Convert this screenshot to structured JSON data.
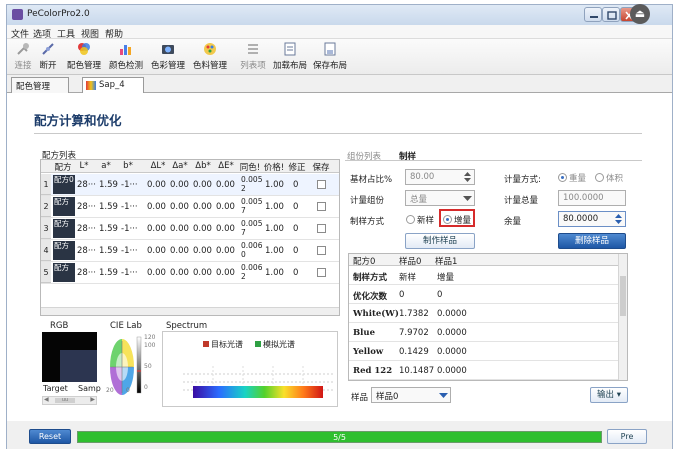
{
  "app": {
    "title": "PeColorPro2.0"
  },
  "menu": [
    "文件",
    "选项",
    "工具",
    "视图",
    "帮助"
  ],
  "toolbar": [
    {
      "label": "连接",
      "icon": "connect-icon",
      "enabled": false
    },
    {
      "label": "断开",
      "icon": "disconnect-icon",
      "enabled": true
    },
    {
      "label": "配色管理",
      "icon": "color-match-icon",
      "enabled": true
    },
    {
      "label": "颜色检测",
      "icon": "color-detect-icon",
      "enabled": true
    },
    {
      "label": "色彩管理",
      "icon": "color-manage-icon",
      "enabled": true
    },
    {
      "label": "色料管理",
      "icon": "colorant-manage-icon",
      "enabled": true
    },
    {
      "label": "列表项",
      "icon": "list-icon",
      "enabled": false
    },
    {
      "label": "加载布局",
      "icon": "load-layout-icon",
      "enabled": true
    },
    {
      "label": "保存布局",
      "icon": "save-layout-icon",
      "enabled": true
    }
  ],
  "tabs": [
    "配色管理",
    "Sap_4"
  ],
  "page": {
    "title": "配方计算和优化"
  },
  "formula_list": {
    "title": "配方列表",
    "columns": [
      "配方",
      "L*",
      "a*",
      "b*",
      "ΔL*",
      "Δa*",
      "Δb*",
      "ΔE*",
      "同色!",
      "价格!",
      "修正",
      "保存"
    ],
    "rows": [
      {
        "index": "1",
        "name": "配方0",
        "L": "28···",
        "a": "1.59",
        "b": "-1···",
        "dL": "0.00",
        "da": "0.00",
        "db": "0.00",
        "dE": "0.00",
        "meta": "0.0052",
        "price": "1.00",
        "fix": "0"
      },
      {
        "index": "2",
        "name": "配方",
        "L": "28···",
        "a": "1.59",
        "b": "-1···",
        "dL": "0.00",
        "da": "0.00",
        "db": "0.00",
        "dE": "0.00",
        "meta": "0.0057",
        "price": "1.00",
        "fix": "0"
      },
      {
        "index": "3",
        "name": "配方",
        "L": "28···",
        "a": "1.59",
        "b": "-1···",
        "dL": "0.00",
        "da": "0.00",
        "db": "0.00",
        "dE": "0.00",
        "meta": "0.0057",
        "price": "1.00",
        "fix": "0"
      },
      {
        "index": "4",
        "name": "配方",
        "L": "28···",
        "a": "1.59",
        "b": "-1···",
        "dL": "0.00",
        "da": "0.00",
        "db": "0.00",
        "dE": "0.00",
        "meta": "0.0060",
        "price": "1.00",
        "fix": "0"
      },
      {
        "index": "5",
        "name": "配方",
        "L": "28···",
        "a": "1.59",
        "b": "-1···",
        "dL": "0.00",
        "da": "0.00",
        "db": "0.00",
        "dE": "0.00",
        "meta": "0.0062",
        "price": "1.00",
        "fix": "0"
      }
    ]
  },
  "rgb_panel": {
    "title": "RGB",
    "target": "Target",
    "sample": "Samp",
    "left_arrow": "◀",
    "right_arrow": "▶",
    "thumb_label": "uu"
  },
  "cielab_panel": {
    "title": "CIE Lab",
    "ticks": [
      "120",
      "100",
      "50",
      "0",
      "20",
      "0"
    ]
  },
  "spectrum_panel": {
    "title": "Spectrum",
    "legend": [
      {
        "name": "目标光谱",
        "color": "#c0392b"
      },
      {
        "name": "模拟光谱",
        "color": "#2ea043"
      }
    ]
  },
  "right_tabs": [
    "组份列表",
    "制样"
  ],
  "form": {
    "substrate_ratio_label": "基材占比%",
    "substrate_ratio_value": "80.00",
    "calc_group_label": "计量组份",
    "calc_group_value": "总量",
    "method_label": "制样方式",
    "method_opt1": "新样",
    "method_opt2": "增量",
    "make_sample_btn": "制作样品",
    "calc_mode_label": "计量方式:",
    "calc_mode_opt1": "重量",
    "calc_mode_opt2": "体积",
    "calc_total_label": "计量总量",
    "calc_total_value": "100.0000",
    "remain_label": "余量",
    "remain_value": "80.0000",
    "delete_sample_btn": "删除样品"
  },
  "sample_table": {
    "headers": [
      "配方0",
      "样品0",
      "样品1"
    ],
    "rows": [
      {
        "label": "制样方式",
        "v0": "新样",
        "v1": "增量"
      },
      {
        "label": "优化次数",
        "v0": "0",
        "v1": "0"
      },
      {
        "label": "White(W)",
        "v0": "1.7382",
        "v1": "0.0000"
      },
      {
        "label": "Blue",
        "v0": "7.9702",
        "v1": "0.0000"
      },
      {
        "label": "Yellow",
        "v0": "0.1429",
        "v1": "0.0000"
      },
      {
        "label": "Red 122",
        "v0": "10.1487",
        "v1": "0.0000"
      }
    ]
  },
  "sample_select": {
    "label": "样品",
    "value": "样品0"
  },
  "export_btn": "输出",
  "status": {
    "reset": "Reset",
    "progress_text": "5/5",
    "progress": 1.0,
    "pre": "Pre"
  }
}
